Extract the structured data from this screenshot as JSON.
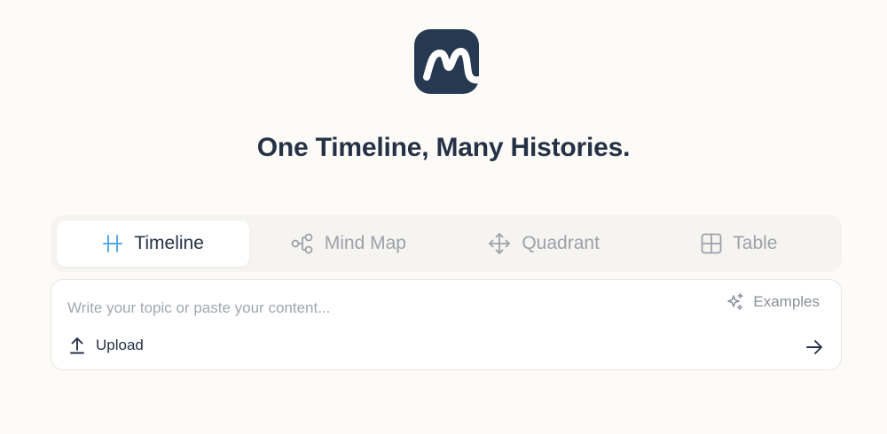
{
  "app": {
    "logo_icon": "brand-m-logo",
    "logo_color": "#273851",
    "headline": "One Timeline, Many Histories."
  },
  "tabs": [
    {
      "label": "Timeline",
      "icon": "timeline-icon",
      "active": true
    },
    {
      "label": "Mind Map",
      "icon": "mind-map-icon",
      "active": false
    },
    {
      "label": "Quadrant",
      "icon": "quadrant-move-icon",
      "active": false
    },
    {
      "label": "Table",
      "icon": "table-grid-icon",
      "active": false
    }
  ],
  "composer": {
    "placeholder": "Write your topic or paste your content...",
    "value": "",
    "examples_label": "Examples",
    "examples_icon": "sparkles-icon",
    "upload_label": "Upload",
    "upload_icon": "upload-icon",
    "send_icon": "arrow-right-icon"
  },
  "colors": {
    "background": "#fcfbf8",
    "accent": "#5aa9e6",
    "text": "#253246",
    "muted": "#9ca1ab"
  }
}
